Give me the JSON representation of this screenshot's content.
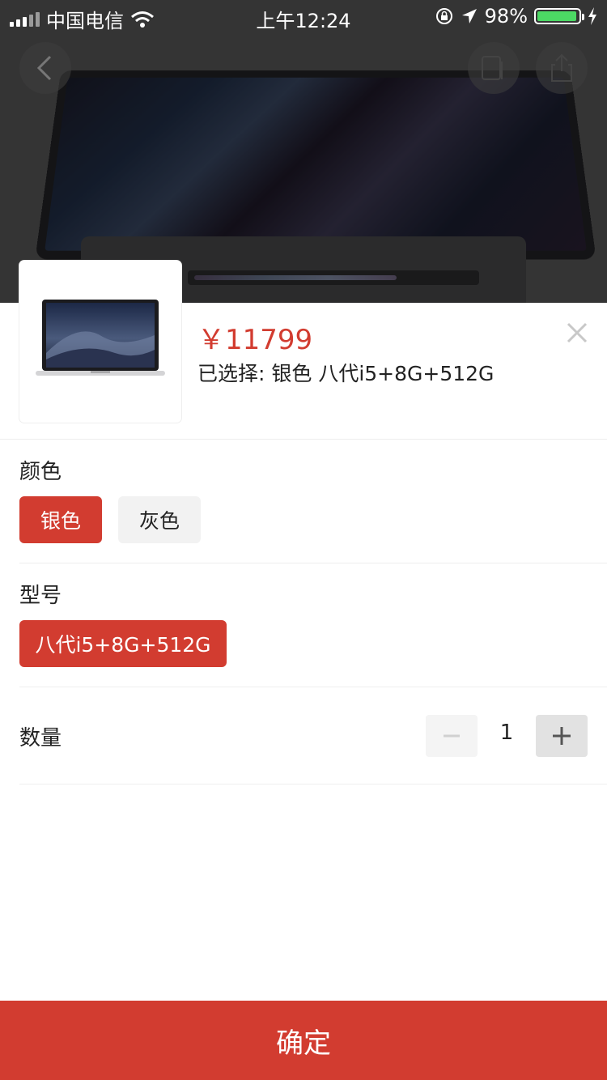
{
  "status_bar": {
    "carrier": "中国电信",
    "time": "上午12:24",
    "battery": "98%",
    "battery_level": 0.98
  },
  "product": {
    "price": "￥11799",
    "selected_text": "已选择: 银色 八代i5+8G+512G"
  },
  "sections": {
    "color": {
      "label": "颜色",
      "options": [
        "银色",
        "灰色"
      ],
      "selected": "银色"
    },
    "model": {
      "label": "型号",
      "options": [
        "八代i5+8G+512G"
      ],
      "selected": "八代i5+8G+512G"
    },
    "quantity": {
      "label": "数量",
      "value": "1"
    }
  },
  "confirm_label": "确定",
  "colors": {
    "accent": "#d23c30",
    "chip_idle": "#f2f2f2",
    "battery_green": "#4cd964"
  },
  "icons": [
    "back-arrow-icon",
    "copy-icon",
    "share-icon",
    "close-icon",
    "minus-icon",
    "plus-icon",
    "wifi-icon",
    "location-arrow-icon",
    "orientation-lock-icon",
    "charging-bolt-icon"
  ]
}
